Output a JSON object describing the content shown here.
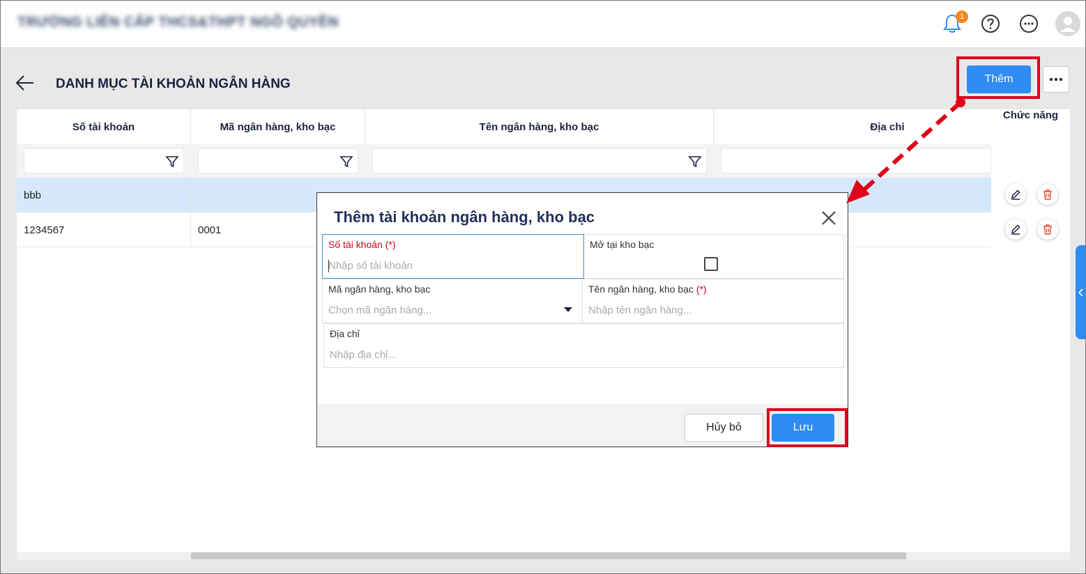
{
  "topbar": {
    "org_name": "TRƯỜNG LIÊN CẤP THCS&THPT NGÔ QUYỀN",
    "notification_count": "1",
    "icons": [
      "bell-icon",
      "help-icon",
      "more-icon",
      "avatar-icon"
    ]
  },
  "page": {
    "title": "DANH MỤC TÀI KHOẢN NGÂN HÀNG",
    "add_label": "Thêm",
    "more_label": "•••"
  },
  "table": {
    "columns": [
      "Số tài khoản",
      "Mã ngân hàng, kho bạc",
      "Tên ngân hàng, kho bạc",
      "Địa chỉ",
      "Chức năng"
    ],
    "rows": [
      {
        "account": "bbb",
        "bank_code": "",
        "bank_name": "",
        "address": ""
      },
      {
        "account": "1234567",
        "bank_code": "0001",
        "bank_name": "",
        "address": ""
      }
    ]
  },
  "dialog": {
    "title": "Thêm tài khoản ngân hàng, kho bạc",
    "fields": {
      "account_number": {
        "label": "Số tài khoản",
        "required": "(*)",
        "placeholder": "Nhập số tài khoản"
      },
      "treasury": {
        "label": "Mở tại kho bạc"
      },
      "bank_code": {
        "label": "Mã ngân hàng, kho bạc",
        "placeholder": "Chọn mã ngân hàng..."
      },
      "bank_name": {
        "label": "Tên ngân hàng, kho bạc",
        "required": "(*)",
        "placeholder": "Nhập tên ngân hàng..."
      },
      "address": {
        "label": "Địa chỉ",
        "placeholder": "Nhập địa chỉ..."
      }
    },
    "cancel_label": "Hủy bỏ",
    "save_label": "Lưu"
  },
  "colors": {
    "accent": "#2f8cf2",
    "highlight": "#e0001b",
    "selected_row": "#d6e8fb",
    "badge": "#f5891f"
  }
}
